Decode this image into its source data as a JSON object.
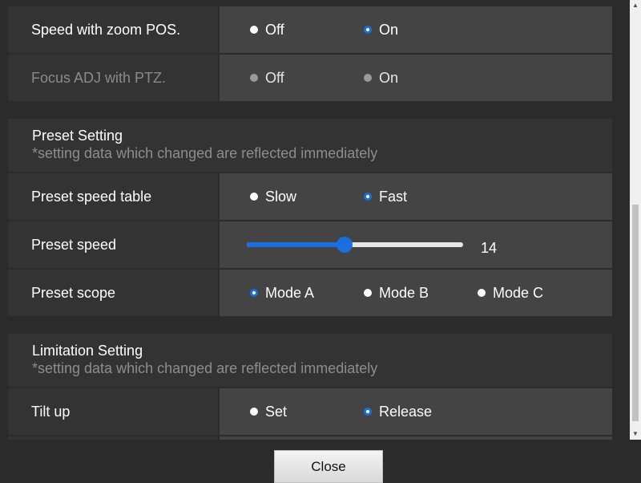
{
  "rows": {
    "speed_zoom": {
      "label": "Speed with zoom POS.",
      "off": "Off",
      "on": "On",
      "selected": "On"
    },
    "focus_adj": {
      "label": "Focus ADJ with PTZ.",
      "off": "Off",
      "on": "On",
      "selected": "none",
      "disabled": true
    },
    "preset_speed_table": {
      "label": "Preset speed table",
      "slow": "Slow",
      "fast": "Fast",
      "selected": "Fast"
    },
    "preset_speed": {
      "label": "Preset speed",
      "value": "14",
      "fraction": 0.45
    },
    "preset_scope": {
      "label": "Preset scope",
      "a": "Mode A",
      "b": "Mode B",
      "c": "Mode C",
      "selected": "Mode A"
    },
    "tilt_up": {
      "label": "Tilt up",
      "set": "Set",
      "release": "Release",
      "selected": "Release"
    }
  },
  "sections": {
    "preset": {
      "title": "Preset Setting",
      "subtitle": "*setting data which changed are reflected immediately"
    },
    "limitation": {
      "title": "Limitation Setting",
      "subtitle": "*setting data which changed are reflected immediately"
    }
  },
  "footer": {
    "close_label": "Close"
  },
  "colors": {
    "accent": "#1a6fe0",
    "label_bg": "#333333",
    "value_bg": "#444444",
    "page_bg": "#2b2b2b"
  }
}
